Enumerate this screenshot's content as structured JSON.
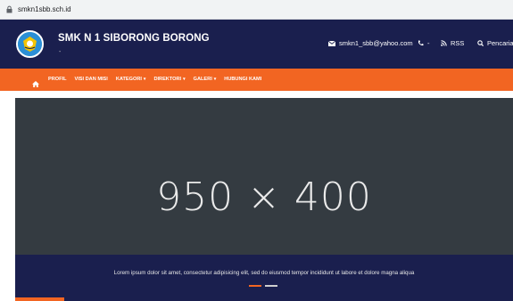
{
  "browser": {
    "url": "smkn1sbb.sch.id"
  },
  "header": {
    "site_title": "SMK N 1 SIBORONG BORONG",
    "tagline": "-",
    "email": "smkn1_sbb@yahoo.com",
    "phone": "-",
    "rss": "RSS",
    "search": "Pencarian"
  },
  "nav": {
    "items": [
      {
        "label": "PROFIL",
        "dropdown": false
      },
      {
        "label": "VISI DAN MISI",
        "dropdown": false
      },
      {
        "label": "KATEGORI",
        "dropdown": true
      },
      {
        "label": "DIREKTORI",
        "dropdown": true
      },
      {
        "label": "GALERI",
        "dropdown": true
      },
      {
        "label": "HUBUNGI KAMI",
        "dropdown": false
      }
    ]
  },
  "slider": {
    "image_label": "950 × 400",
    "caption": "Lorem ipsum dolor sit amet, consectetur adipisicing elit, sed do eiusmod tempor incididunt ut labore et dolore magna aliqua",
    "active_index": 0,
    "slide_count": 2
  },
  "colors": {
    "header_bg": "#1a1f4e",
    "nav_bg": "#f26522",
    "slide_bg": "#343b41"
  }
}
